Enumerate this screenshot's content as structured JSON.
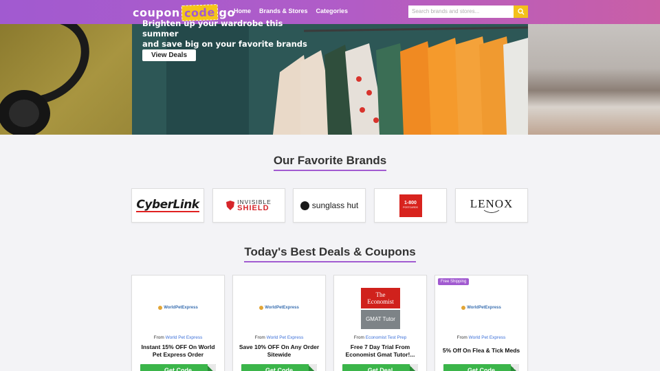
{
  "header": {
    "logo": {
      "part1": "coupon",
      "part2": "code",
      "part3": "go"
    },
    "nav": [
      "Home",
      "Brands & Stores",
      "Categories"
    ],
    "search_placeholder": "Search brands and stores..."
  },
  "hero": {
    "line1": "Brighten up your wardrobe this summer",
    "line2": "and save big on your favorite brands",
    "button": "View Deals"
  },
  "brands_section": {
    "title": "Our Favorite Brands",
    "brands": [
      {
        "name": "CyberLink"
      },
      {
        "name": "INVISIBLE",
        "name2": "SHIELD"
      },
      {
        "name": "sunglass hut"
      },
      {
        "name": "1-800",
        "name2": "POSTCARDS"
      },
      {
        "name": "LENOX"
      }
    ]
  },
  "deals_section": {
    "title": "Today's Best Deals & Coupons",
    "deals": [
      {
        "from_label": "From",
        "store": "World Pet Express",
        "title": "Instant 15% OFF On World Pet Express Order",
        "cta": "Get Code",
        "logo_text": "WorldPetExpress"
      },
      {
        "from_label": "From",
        "store": "World Pet Express",
        "title": "Save 10% OFF On Any Order Sitewide",
        "cta": "Get Code",
        "logo_text": "WorldPetExpress"
      },
      {
        "from_label": "From",
        "store": "Economist Test Prep",
        "title": "Free 7 Day Trial From Economist Gmat Tutor!...",
        "cta": "Get Deal",
        "logo_line1": "The",
        "logo_line2": "Economist",
        "logo_line3": "GMAT Tutor"
      },
      {
        "from_label": "From",
        "store": "World Pet Express",
        "title": "5% Off On Flea & Tick Meds",
        "cta": "Get Code",
        "badge": "Free Shipping",
        "logo_text": "WorldPetExpress"
      }
    ]
  }
}
